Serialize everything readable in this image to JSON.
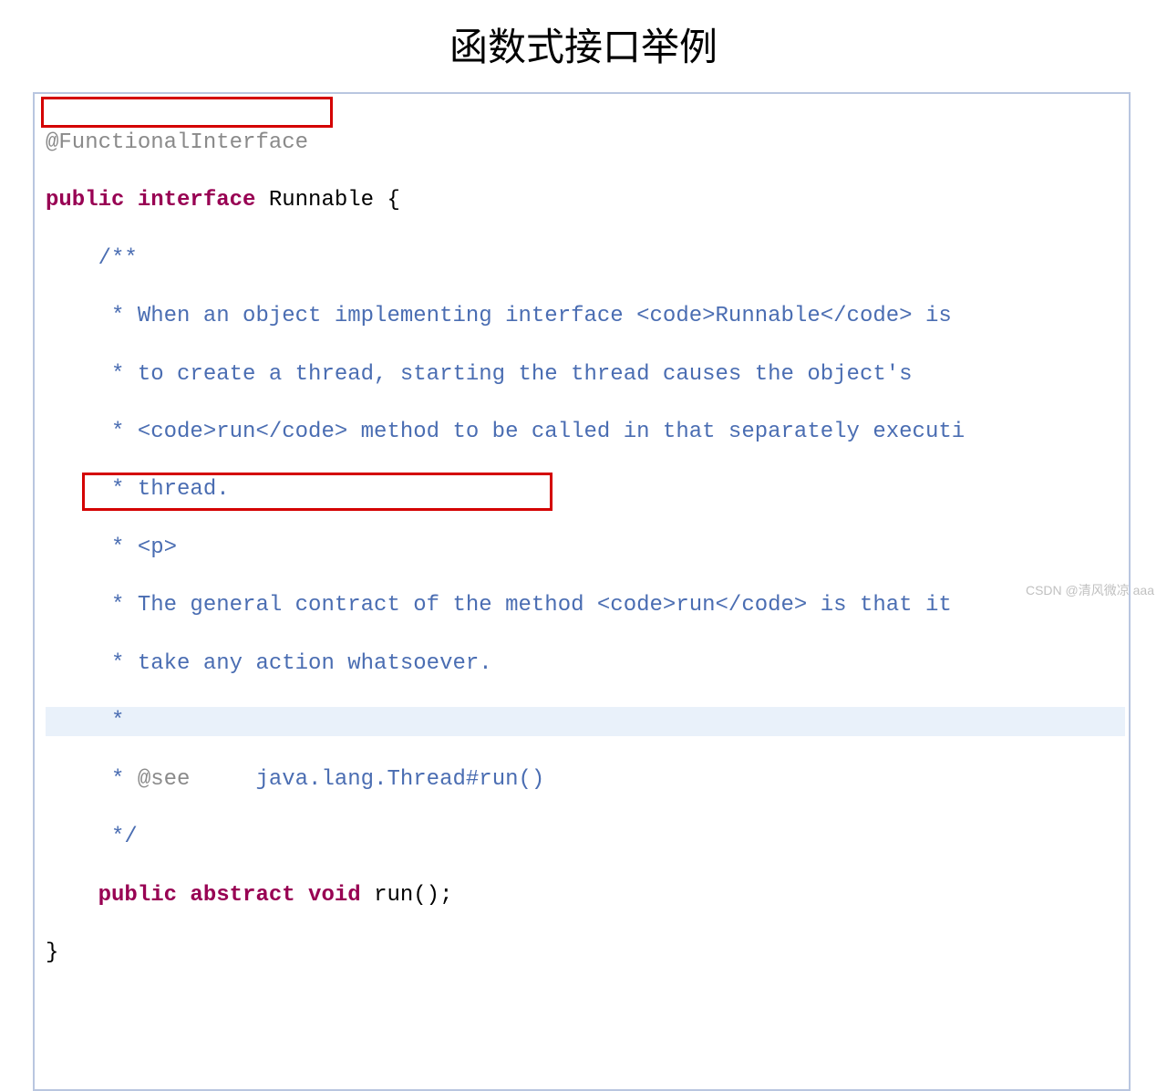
{
  "title": "函数式接口举例",
  "code": {
    "line1": "@FunctionalInterface",
    "line2_kw": "public interface ",
    "line2_name": "Runnable {",
    "line3": "    /**",
    "line4": "     * When an object implementing interface <code>Runnable</code> is",
    "line5": "     * to create a thread, starting the thread causes the object's",
    "line6": "     * <code>run</code> method to be called in that separately executi",
    "line7": "     * thread.",
    "line8": "     * <p>",
    "line9": "     * The general contract of the method <code>run</code> is that it",
    "line10": "     * take any action whatsoever.",
    "line11": "     *",
    "line12a": "     * ",
    "line12_see": "@see",
    "line12b": "     java.lang.Thread#run()",
    "line13": "     */",
    "line14_pad": "    ",
    "line14_kw": "public abstract void ",
    "line14_call": "run();",
    "line15": "}"
  },
  "watermark": "CSDN @清风微凉 aaa"
}
